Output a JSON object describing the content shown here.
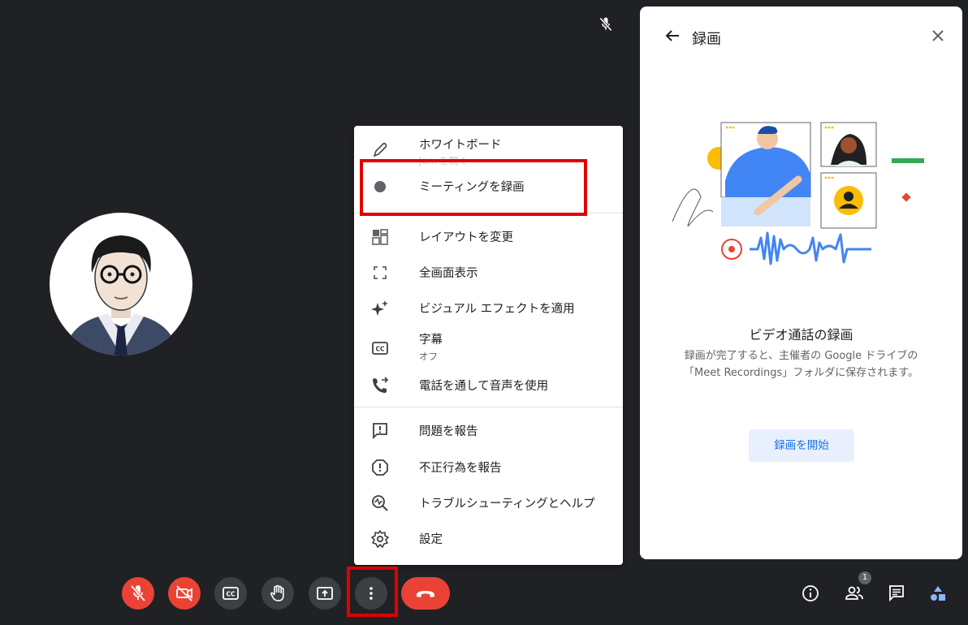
{
  "window": {
    "muted_icon": "mic-off-icon"
  },
  "menu": {
    "items": [
      {
        "label": "ホワイトボード",
        "sub": "Jam を開く",
        "icon": "pencil-icon"
      },
      {
        "label": "ミーティングを録画",
        "icon": "record-dot-icon"
      },
      {
        "label": "レイアウトを変更",
        "icon": "layout-icon"
      },
      {
        "label": "全画面表示",
        "icon": "fullscreen-icon"
      },
      {
        "label": "ビジュアル エフェクトを適用",
        "icon": "sparkle-icon"
      },
      {
        "label": "字幕",
        "sub": "オフ",
        "icon": "cc-icon"
      },
      {
        "label": "電話を通して音声を使用",
        "icon": "phone-forward-icon"
      },
      {
        "label": "問題を報告",
        "icon": "feedback-icon"
      },
      {
        "label": "不正行為を報告",
        "icon": "report-icon"
      },
      {
        "label": "トラブルシューティングとヘルプ",
        "icon": "troubleshoot-icon"
      },
      {
        "label": "設定",
        "icon": "gear-icon"
      }
    ]
  },
  "panel": {
    "title": "録画",
    "heading": "ビデオ通話の録画",
    "description": "録画が完了すると、主催者の Google ドライブの「Meet Recordings」フォルダに保存されます。",
    "start_button": "録画を開始"
  },
  "bottom_right": {
    "participants_count": "1"
  },
  "colors": {
    "background": "#202124",
    "red": "#ea4335",
    "blue": "#1a73e8",
    "highlight": "#e00000"
  }
}
